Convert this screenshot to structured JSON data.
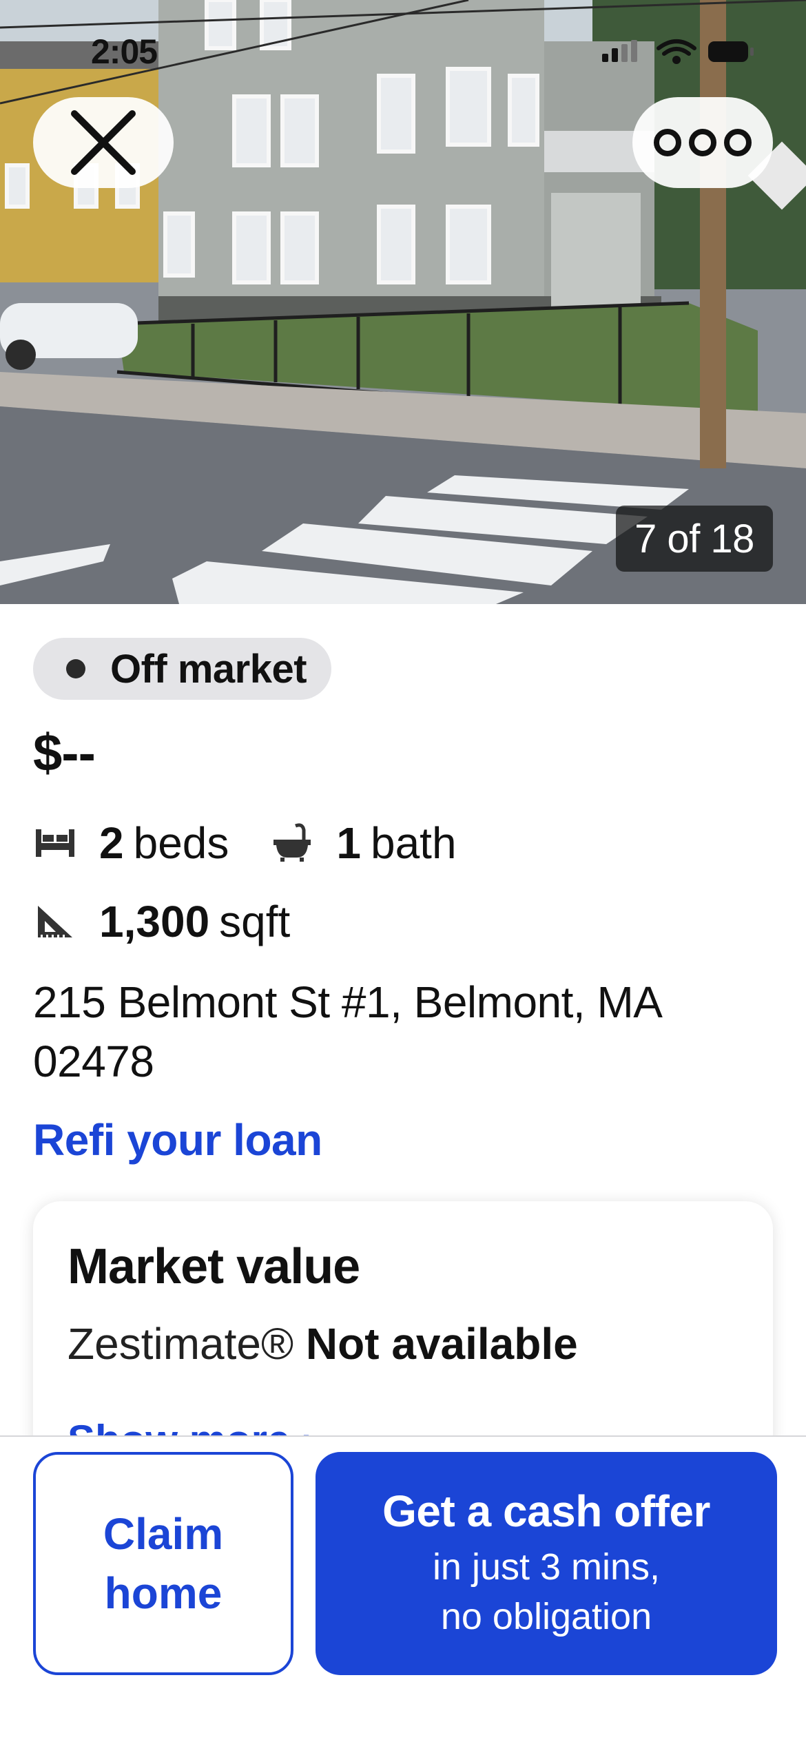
{
  "status_bar": {
    "time": "2:05",
    "icons": [
      "signal-icon",
      "wifi-icon",
      "battery-icon"
    ]
  },
  "gallery": {
    "counter": "7 of 18",
    "close_icon": "close-icon",
    "more_icon": "more-options-icon"
  },
  "listing": {
    "status": "Off market",
    "price": "$--",
    "beds_num": "2",
    "beds_unit": "beds",
    "baths_num": "1",
    "baths_unit": "bath",
    "sqft_num": "1,300",
    "sqft_unit": "sqft",
    "address": "215 Belmont St #1, Belmont, MA 02478"
  },
  "refi_link": "Refi your loan",
  "market_value": {
    "title": "Market value",
    "zestimate_label": "Zestimate®",
    "zestimate_value": "Not available",
    "show_more": "Show more"
  },
  "actions": {
    "claim_home": "Claim\nhome",
    "cash_offer_title": "Get a cash offer",
    "cash_offer_sub": "in just 3 mins,\nno obligation"
  },
  "colors": {
    "accent": "#1b45d6",
    "pill_bg": "#e4e4e7"
  }
}
